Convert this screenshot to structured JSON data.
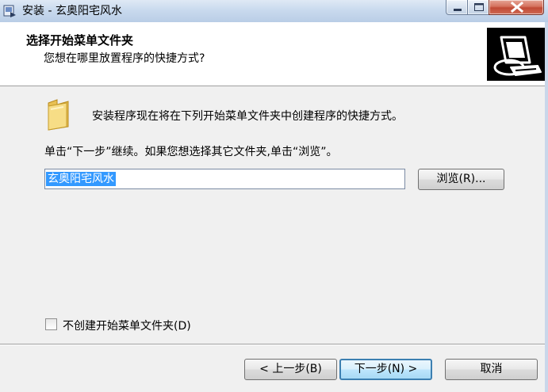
{
  "window": {
    "title": "安装 - 玄奥阳宅风水"
  },
  "header": {
    "title": "选择开始菜单文件夹",
    "subtitle": "您想在哪里放置程序的快捷方式?",
    "logo_icon": "computer-installer-icon"
  },
  "body": {
    "intro": "安装程序现在将在下列开始菜单文件夹中创建程序的快捷方式。",
    "instruction": "单击“下一步”继续。如果您想选择其它文件夹,单击“浏览”。",
    "folder_icon": "folder-icon",
    "path_value": "玄奥阳宅风水",
    "browse_label": "浏览(R)...",
    "checkbox_label": "不创建开始菜单文件夹(D)",
    "checkbox_checked": false
  },
  "footer": {
    "back_label": "< 上一步(B)",
    "next_label": "下一步(N) >",
    "cancel_label": "取消"
  },
  "colors": {
    "selection": "#3399ff",
    "close_button": "#c04a35",
    "default_button_border": "#3c7fb1"
  }
}
